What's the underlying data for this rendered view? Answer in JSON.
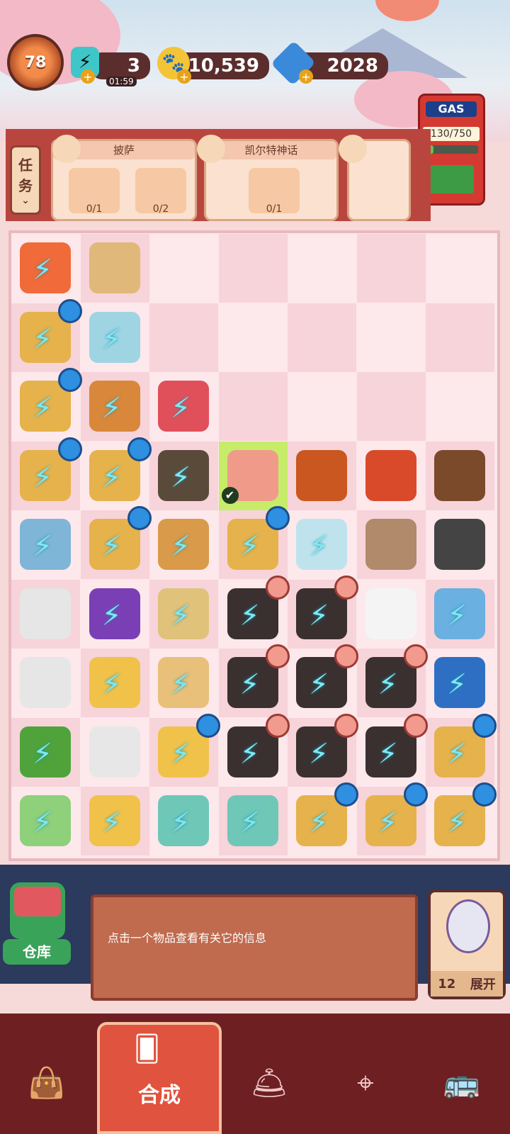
{
  "header": {
    "level": "78",
    "energy": {
      "value": "3",
      "timer": "01:59"
    },
    "coins": "10,539",
    "gems": "2028"
  },
  "gas": {
    "title": "GAS",
    "reading": "130/750",
    "fill": 0.17
  },
  "tasks": {
    "tab_label_top": "任",
    "tab_label_bottom": "务",
    "cards": [
      {
        "title": "披萨",
        "requirements": [
          {
            "icon": "pizza-icon",
            "count": "0/1"
          },
          {
            "icon": "sauce-bottle-icon",
            "count": "0/2"
          }
        ]
      },
      {
        "title": "凯尔特神话",
        "requirements": [
          {
            "icon": "sword-crystal-icon",
            "count": "0/1"
          }
        ]
      },
      {
        "title": "",
        "requirements": []
      }
    ]
  },
  "board": {
    "rows": 9,
    "cols": 7
  },
  "info": {
    "message": "点击一个物品查看有关它的信息"
  },
  "storage": {
    "label": "仓库"
  },
  "expand": {
    "count": "12",
    "label": "展开"
  },
  "nav": {
    "items": [
      {
        "icon": "shop-bag-icon"
      },
      {
        "icon": "merge-cards-icon",
        "label": "合成"
      },
      {
        "icon": "cloche-icon"
      },
      {
        "icon": "map-icon"
      },
      {
        "icon": "bus-icon"
      }
    ]
  }
}
